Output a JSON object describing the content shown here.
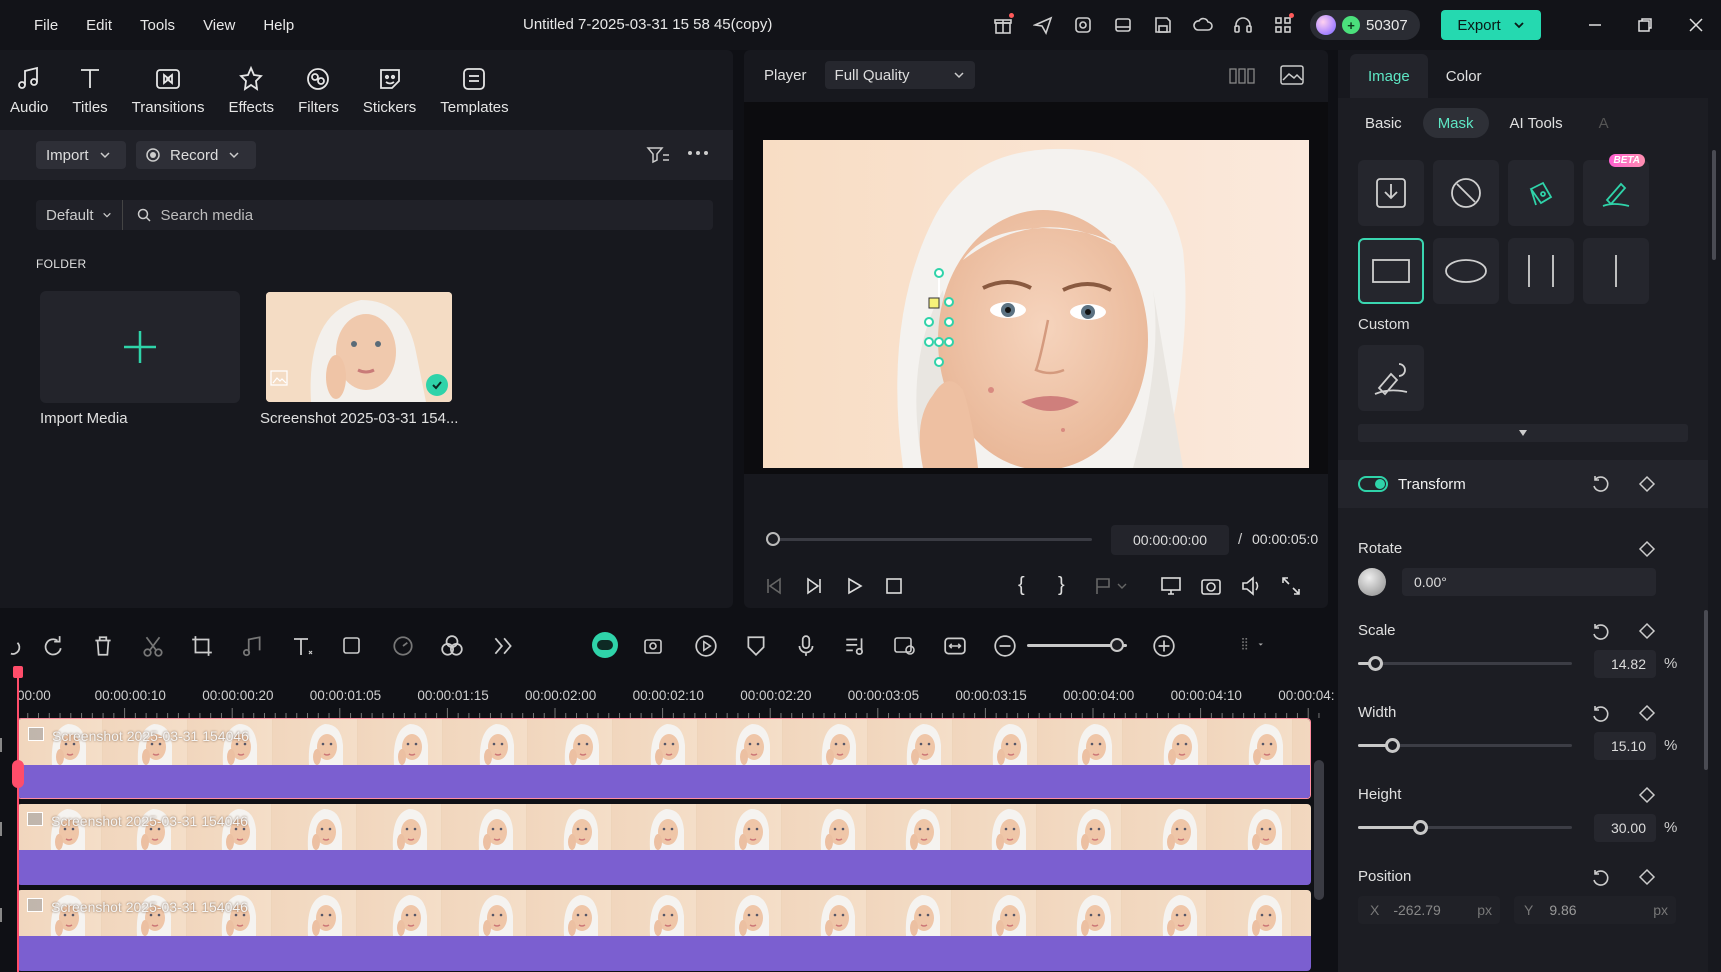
{
  "menubar": {
    "items": [
      "File",
      "Edit",
      "Tools",
      "View",
      "Help"
    ],
    "title": "Untitled 7-2025-03-31 15 58 45(copy)",
    "credits": "50307",
    "export_label": "Export"
  },
  "library": {
    "tabs": [
      {
        "label": "Audio",
        "icon": "audio-icon"
      },
      {
        "label": "Titles",
        "icon": "titles-icon"
      },
      {
        "label": "Transitions",
        "icon": "transitions-icon"
      },
      {
        "label": "Effects",
        "icon": "effects-icon"
      },
      {
        "label": "Filters",
        "icon": "filters-icon"
      },
      {
        "label": "Stickers",
        "icon": "stickers-icon"
      },
      {
        "label": "Templates",
        "icon": "templates-icon"
      }
    ],
    "import_label": "Import",
    "record_label": "Record",
    "sort_label": "Default",
    "search_placeholder": "Search media",
    "folder_label": "FOLDER",
    "import_media_label": "Import Media",
    "media_item_name": "Screenshot 2025-03-31 154..."
  },
  "player": {
    "label": "Player",
    "quality": "Full Quality",
    "current_time": "00:00:00:00",
    "separator": "/",
    "total_time": "00:00:05:0"
  },
  "inspector": {
    "tabs": [
      "Image",
      "Color"
    ],
    "subtabs": [
      "Basic",
      "Mask",
      "AI Tools",
      "A"
    ],
    "active_tab": "Image",
    "active_subtab": "Mask",
    "beta_label": "BETA",
    "custom_label": "Custom",
    "transform_label": "Transform",
    "rotate": {
      "label": "Rotate",
      "value": "0.00°"
    },
    "scale": {
      "label": "Scale",
      "value": "14.82",
      "unit": "%",
      "level": 0.08
    },
    "width": {
      "label": "Width",
      "value": "15.10",
      "unit": "%",
      "level": 0.16
    },
    "height": {
      "label": "Height",
      "value": "30.00",
      "unit": "%",
      "level": 0.29
    },
    "position": {
      "label": "Position",
      "x_label": "X",
      "x_value": "-262.79",
      "x_unit": "px",
      "y_label": "Y",
      "y_value": "9.86",
      "y_unit": "px"
    }
  },
  "timeline": {
    "ruler": [
      "00:00",
      "00:00:00:10",
      "00:00:00:20",
      "00:00:01:05",
      "00:00:01:15",
      "00:00:02:00",
      "00:00:02:10",
      "00:00:02:20",
      "00:00:03:05",
      "00:00:03:15",
      "00:00:04:00",
      "00:00:04:10",
      "00:00:04:"
    ],
    "clip_name": "Screenshot 2025-03-31 154046"
  },
  "colors": {
    "accent": "#25d9b0",
    "clip_band": "#7b5fd0",
    "playhead": "#ff4d6a"
  }
}
